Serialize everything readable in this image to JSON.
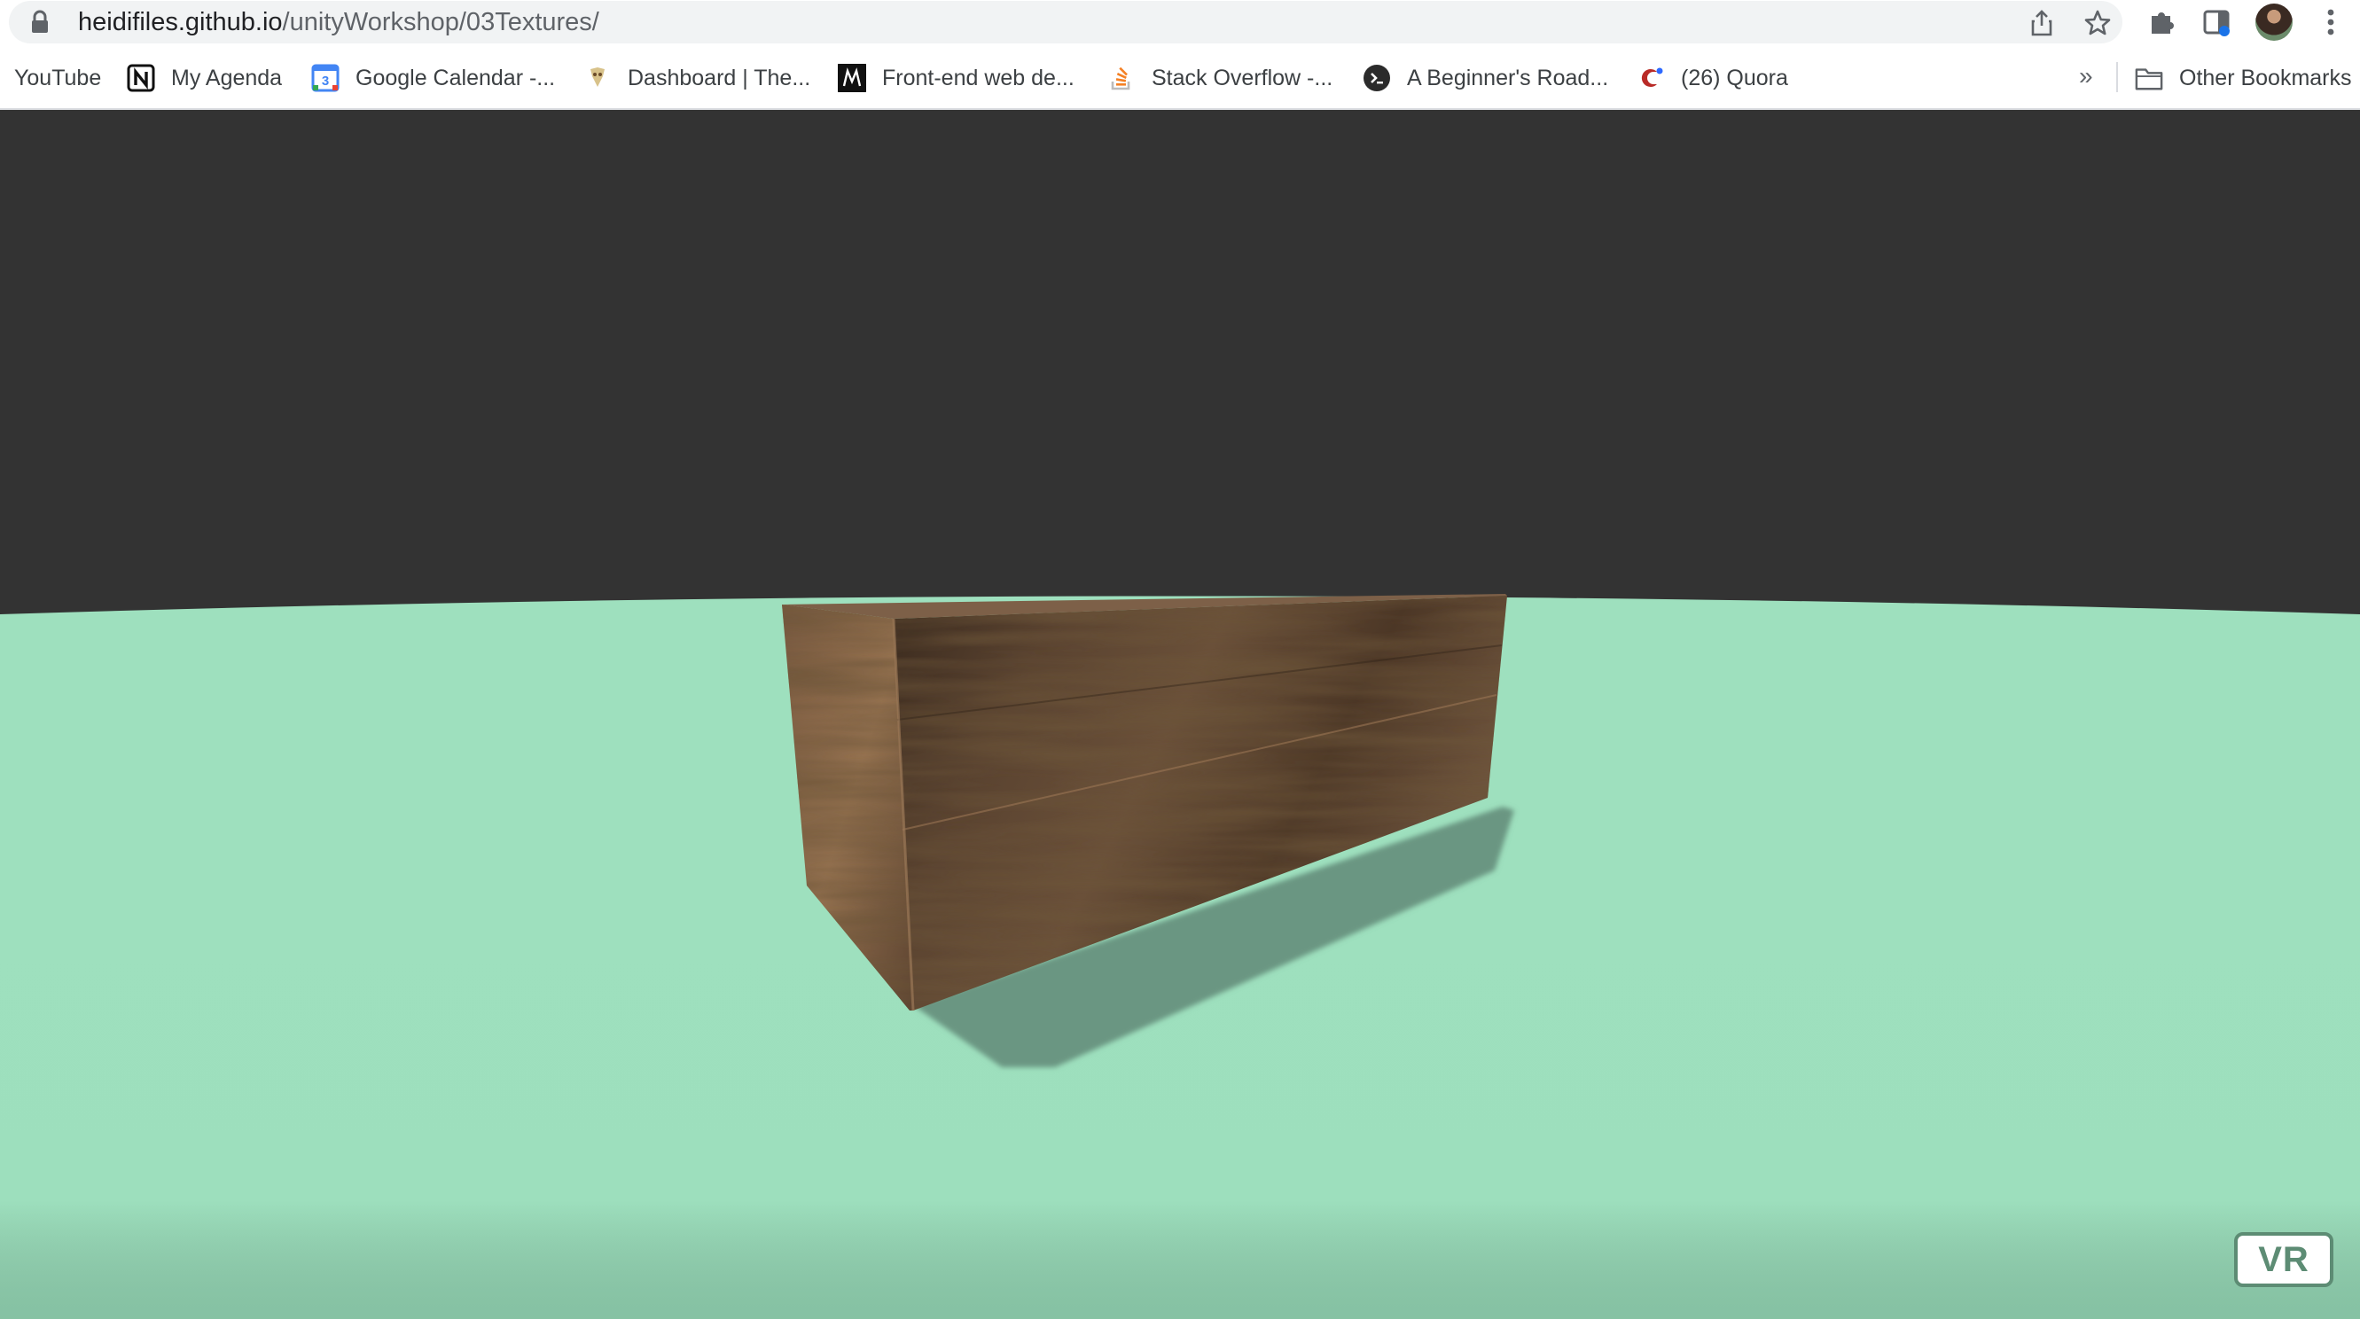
{
  "browser": {
    "url_host": "heidifiles.github.io",
    "url_path": "/unityWorkshop/03Textures/",
    "icons": [
      "lock-icon",
      "share-icon",
      "star-icon",
      "extensions-icon",
      "side-panel-icon",
      "profile-avatar",
      "menu-icon"
    ]
  },
  "bookmarks": {
    "items": [
      {
        "label": "YouTube",
        "icon": "none"
      },
      {
        "label": "My Agenda",
        "icon": "notion-icon"
      },
      {
        "label": "Google Calendar -...",
        "icon": "calendar-icon"
      },
      {
        "label": "Dashboard | The...",
        "icon": "dashboard-icon"
      },
      {
        "label": "Front-end web de...",
        "icon": "m-icon"
      },
      {
        "label": "Stack Overflow -...",
        "icon": "stack-overflow-icon"
      },
      {
        "label": "A Beginner's Road...",
        "icon": "terminal-icon"
      },
      {
        "label": "(26) Quora",
        "icon": "quora-icon"
      }
    ],
    "overflow": "»",
    "other": "Other Bookmarks"
  },
  "scene": {
    "sky_color": "#333333",
    "ground_color": "#9ee0be",
    "shadow_color": "#6a9682",
    "object": "wooden-box",
    "vr_button": "VR"
  }
}
